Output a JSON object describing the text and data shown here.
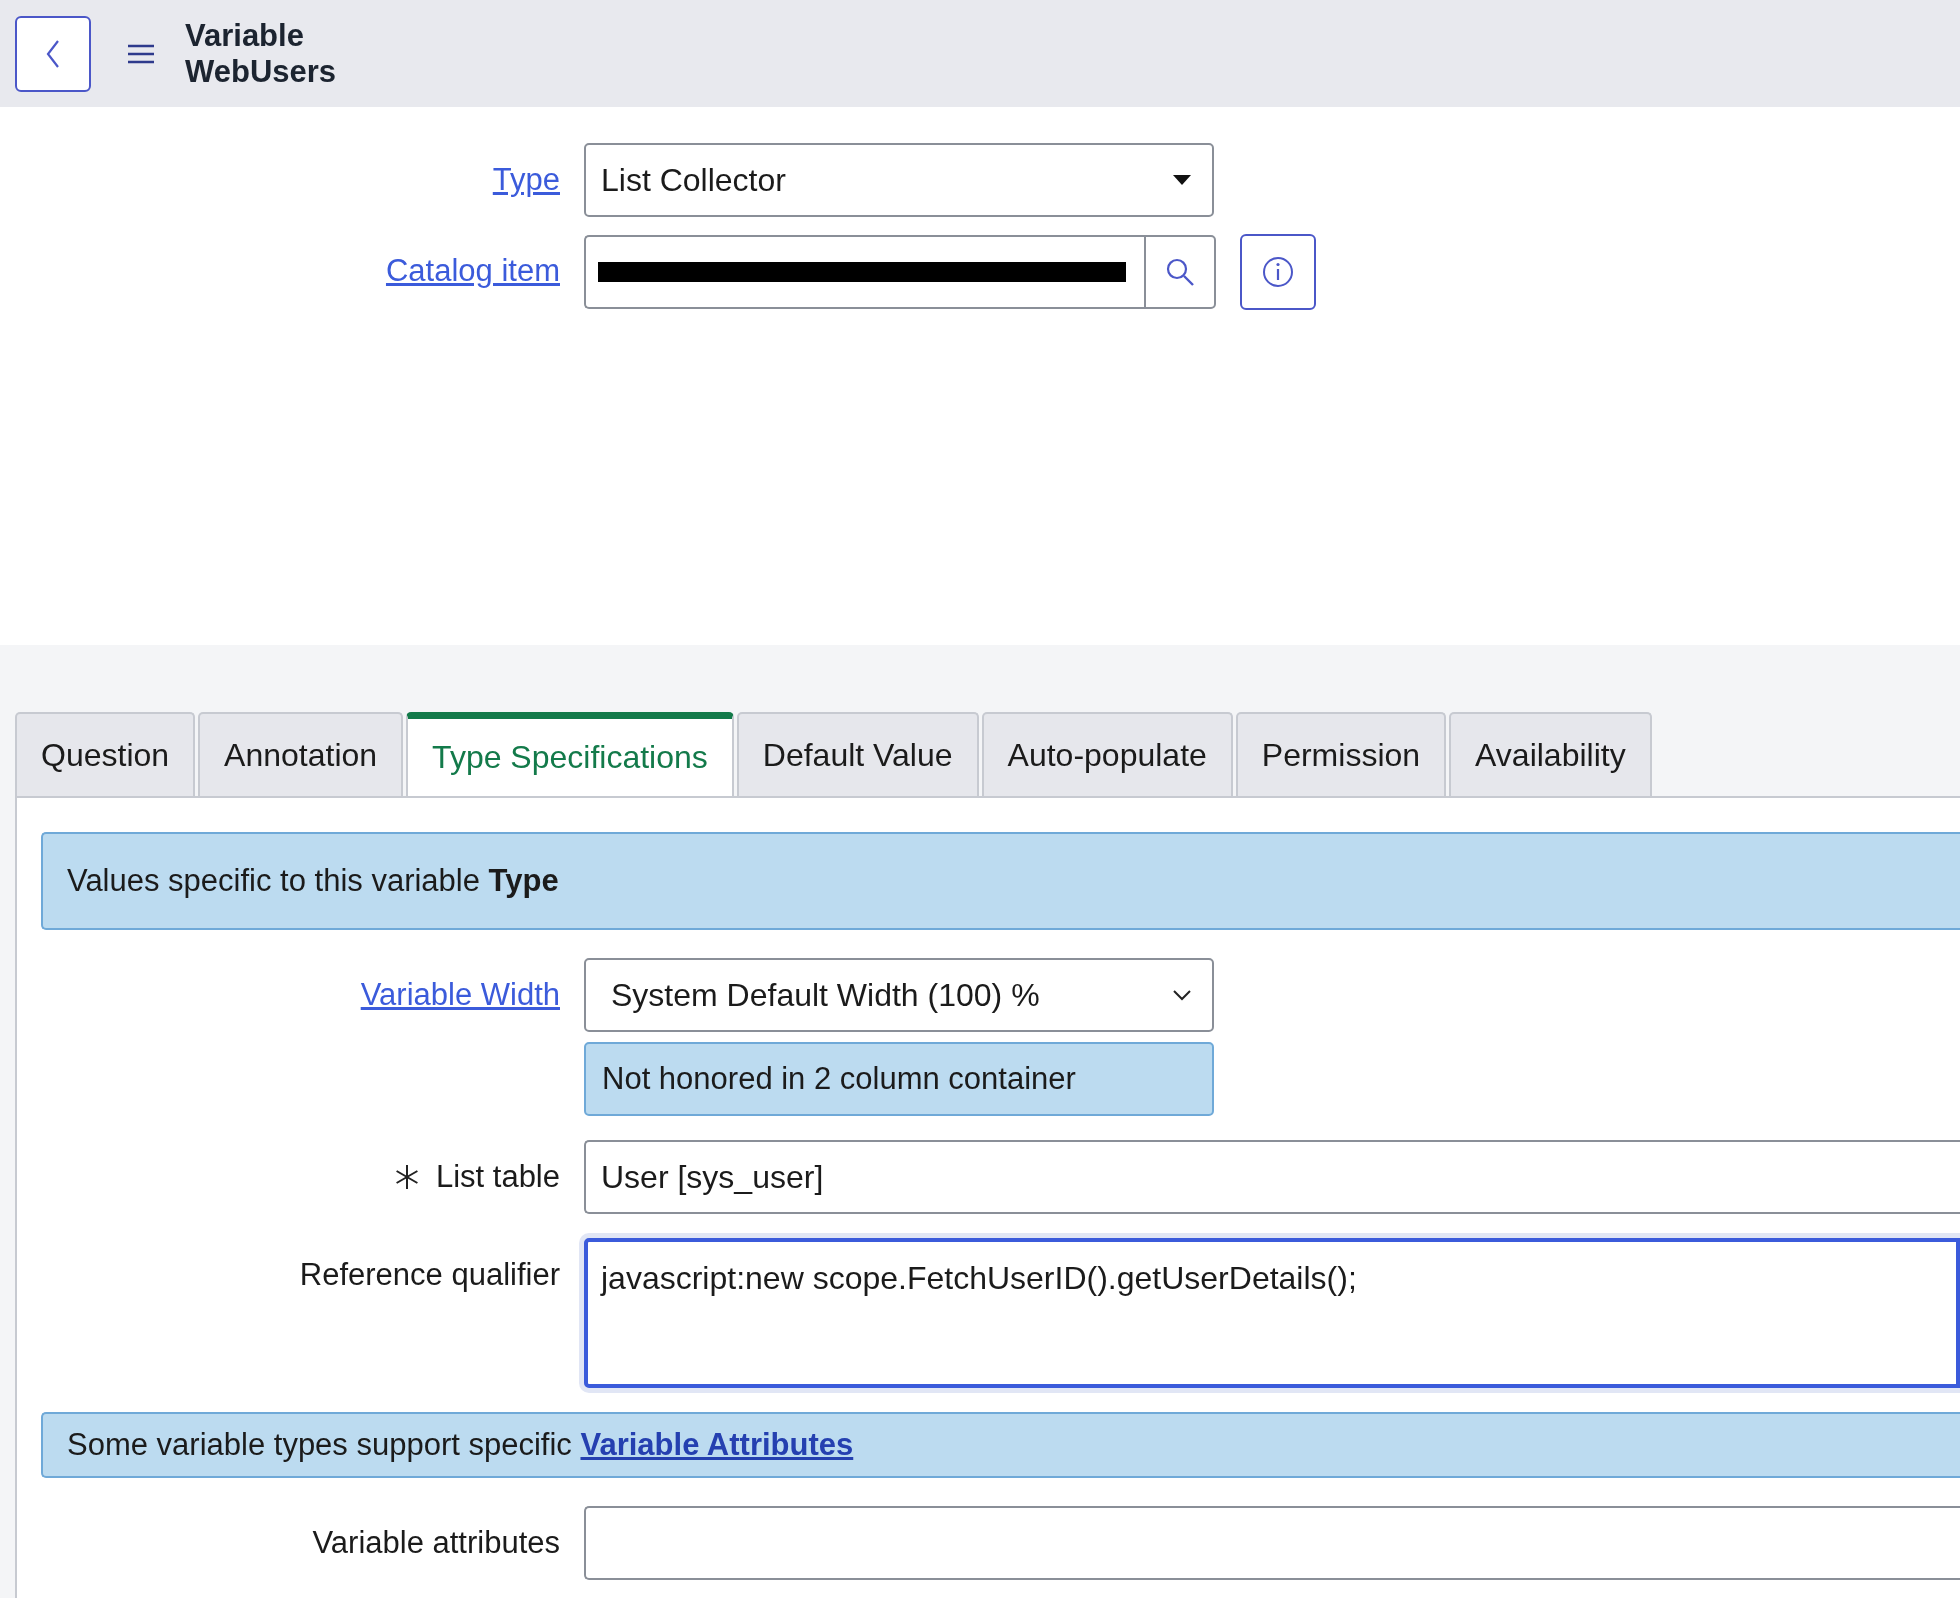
{
  "header": {
    "record_type": "Variable",
    "record_name": "WebUsers"
  },
  "form": [
    {
      "kind": "select",
      "label": "Type",
      "link": true,
      "value": "List Collector"
    },
    {
      "kind": "reference",
      "label": "Catalog item",
      "link": true,
      "redacted": true
    }
  ],
  "tabs": [
    {
      "label": "Question",
      "selected": false
    },
    {
      "label": "Annotation",
      "selected": false
    },
    {
      "label": "Type Specifications",
      "selected": true
    },
    {
      "label": "Default Value",
      "selected": false
    },
    {
      "label": "Auto-populate",
      "selected": false
    },
    {
      "label": "Permission",
      "selected": false
    },
    {
      "label": "Availability",
      "selected": false
    }
  ],
  "panel": [
    {
      "kind": "banner",
      "text": "Values specific to this variable **Type**"
    },
    {
      "kind": "select",
      "label": "Variable Width",
      "link": true,
      "value": "System Default Width (100) %",
      "note": "Not honored in 2 column container"
    },
    {
      "kind": "text",
      "label": "List table",
      "link": false,
      "required": true,
      "value": "User [sys_user]"
    },
    {
      "kind": "textarea",
      "label": "Reference qualifier",
      "link": false,
      "focused": true,
      "value": "javascript:new scope.FetchUserID().getUserDetails();"
    },
    {
      "kind": "banner",
      "text": "Some variable types support specific",
      "link": "Variable Attributes"
    },
    {
      "kind": "text",
      "label": "Variable attributes",
      "link": false,
      "required": false
    }
  ]
}
